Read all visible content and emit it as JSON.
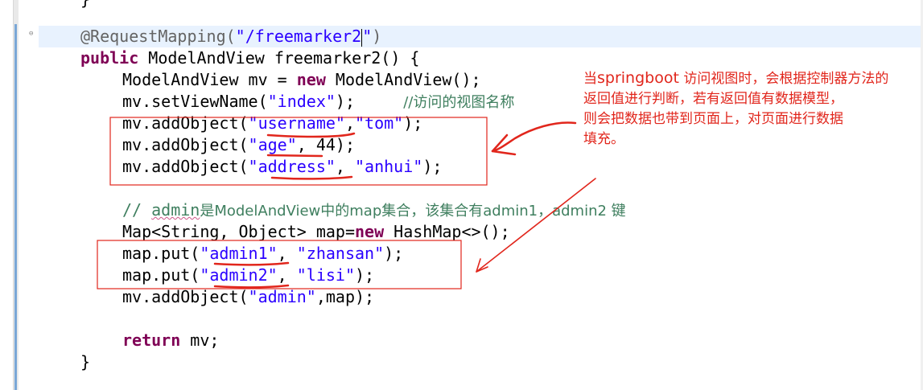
{
  "code": {
    "closing_brace_top": "}",
    "annotation": "@RequestMapping(",
    "annotation_path": "\"/freemarker2",
    "annotation_path_end": "\")",
    "method_kw": "public",
    "method_sig": " ModelAndView freemarker2() {",
    "mv_decl": "ModelAndView mv = ",
    "new_kw": "new",
    "mv_new": " ModelAndView();",
    "set_view_a": "mv.setViewName(",
    "set_view_str": "\"index\"",
    "set_view_b": ");",
    "set_view_comment": "//访问的视图名称",
    "add1_a": "mv.addObject(",
    "add1_s1": "\"username\"",
    "add1_comma": ",",
    "add1_s2": "\"tom\"",
    "add1_b": ");",
    "add2_a": "mv.addObject(",
    "add2_s1": "\"age\"",
    "add2_b": ", 44);",
    "add3_a": "mv.addObject(",
    "add3_s1": "\"address\"",
    "add3_comma": ", ",
    "add3_s2": "\"anhui\"",
    "add3_b": ");",
    "comment2_a": "// ",
    "comment2_admin": "admin",
    "comment2_b": "是ModelAndView中的map集合，该集合有admin1，admin2 键",
    "map_decl_a": "Map<String, Object> map=",
    "map_new_kw": "new",
    "map_decl_b": " HashMap<>();",
    "put1_a": "map.put(",
    "put1_s1": "\"admin1\"",
    "put1_comma": ", ",
    "put1_s2": "\"zhansan\"",
    "put1_b": ");",
    "put2_a": "map.put(",
    "put2_s1": "\"admin2\"",
    "put2_comma": ", ",
    "put2_s2": "\"lisi\"",
    "put2_b": ");",
    "add4_a": "mv.addObject(",
    "add4_s1": "\"admin\"",
    "add4_b": ",map);",
    "return_kw": "return",
    "return_b": " mv;",
    "closing_brace": "}"
  },
  "note": {
    "line1_a": "当",
    "line1_latin": "springboot",
    "line1_b": " 访问视图时，会根据控制器方法的",
    "line2": "返回值进行判断，若有返回值有数据模型，",
    "line3": "则会把数据也带到页面上，对页面进行数据",
    "line4": "填充。"
  },
  "colors": {
    "keyword": "#7f0055",
    "string": "#2a00ff",
    "comment": "#3f7f5f",
    "annotation": "#646464",
    "markup_red": "#e1261c",
    "current_line": "#e8f2fe"
  }
}
